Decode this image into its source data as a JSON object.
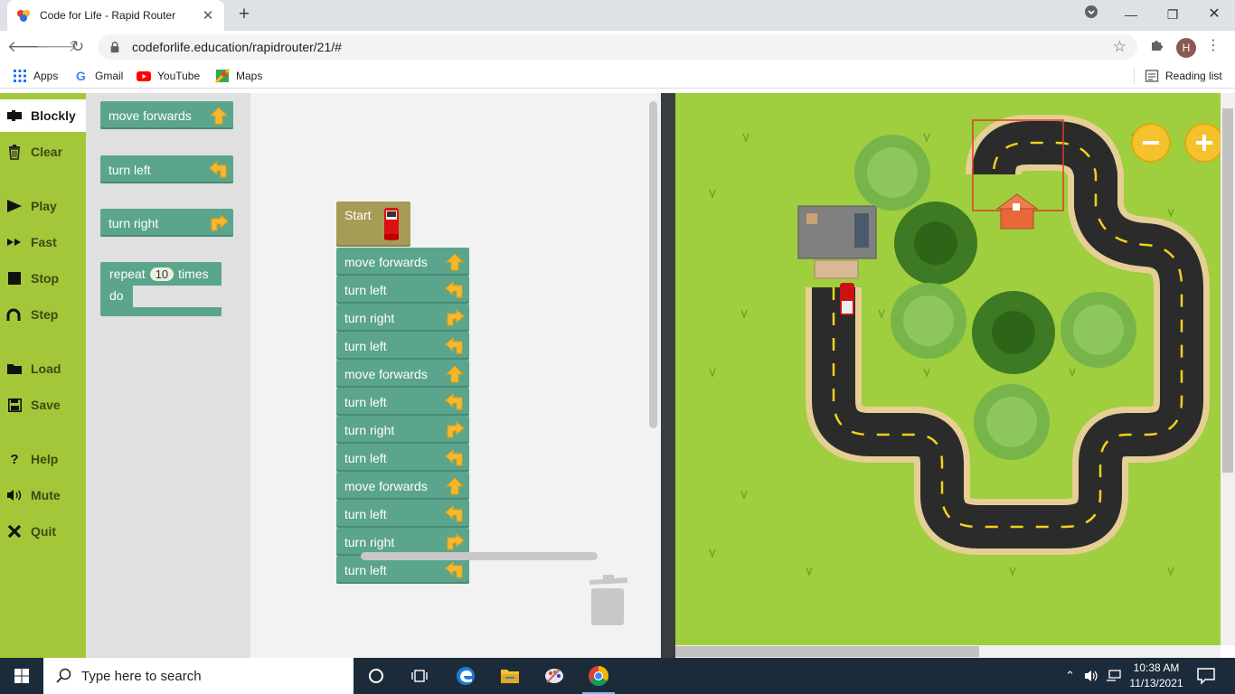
{
  "browser": {
    "tab_title": "Code for Life - Rapid Router",
    "new_tab": "+",
    "url": "codeforlife.education/rapidrouter/21/#",
    "profile_initial": "H",
    "bookmarks": {
      "apps": "Apps",
      "gmail": "Gmail",
      "youtube": "YouTube",
      "maps": "Maps",
      "reading_list": "Reading list"
    }
  },
  "sidebar": {
    "items": [
      {
        "label": "Blockly",
        "icon": "puzzle-icon"
      },
      {
        "label": "Clear",
        "icon": "trash-icon"
      },
      {
        "label": "Play",
        "icon": "play-icon"
      },
      {
        "label": "Fast",
        "icon": "fast-forward-icon"
      },
      {
        "label": "Stop",
        "icon": "stop-icon"
      },
      {
        "label": "Step",
        "icon": "step-icon"
      },
      {
        "label": "Load",
        "icon": "folder-icon"
      },
      {
        "label": "Save",
        "icon": "save-icon"
      },
      {
        "label": "Help",
        "icon": "question-icon"
      },
      {
        "label": "Mute",
        "icon": "speaker-icon"
      },
      {
        "label": "Quit",
        "icon": "close-icon"
      }
    ]
  },
  "toolbox": {
    "move_forwards": "move forwards",
    "turn_left": "turn left",
    "turn_right": "turn right",
    "repeat_label": "repeat",
    "repeat_count": "10",
    "repeat_times": "times",
    "repeat_do": "do"
  },
  "program": {
    "start_label": "Start",
    "blocks": [
      {
        "label": "move forwards",
        "dir": "forward"
      },
      {
        "label": "turn left",
        "dir": "left"
      },
      {
        "label": "turn right",
        "dir": "right"
      },
      {
        "label": "turn left",
        "dir": "left"
      },
      {
        "label": "move forwards",
        "dir": "forward"
      },
      {
        "label": "turn left",
        "dir": "left"
      },
      {
        "label": "turn right",
        "dir": "right"
      },
      {
        "label": "turn left",
        "dir": "left"
      },
      {
        "label": "move forwards",
        "dir": "forward"
      },
      {
        "label": "turn left",
        "dir": "left"
      },
      {
        "label": "turn right",
        "dir": "right"
      },
      {
        "label": "turn left",
        "dir": "left"
      }
    ]
  },
  "taskbar": {
    "search_placeholder": "Type here to search",
    "time": "10:38 AM",
    "date": "11/13/2021"
  },
  "colors": {
    "sidebar": "#a3c739",
    "block": "#5ba58c",
    "start_block": "#a59c56",
    "grass": "#9fce3f",
    "arrow": "#f5b82e"
  }
}
